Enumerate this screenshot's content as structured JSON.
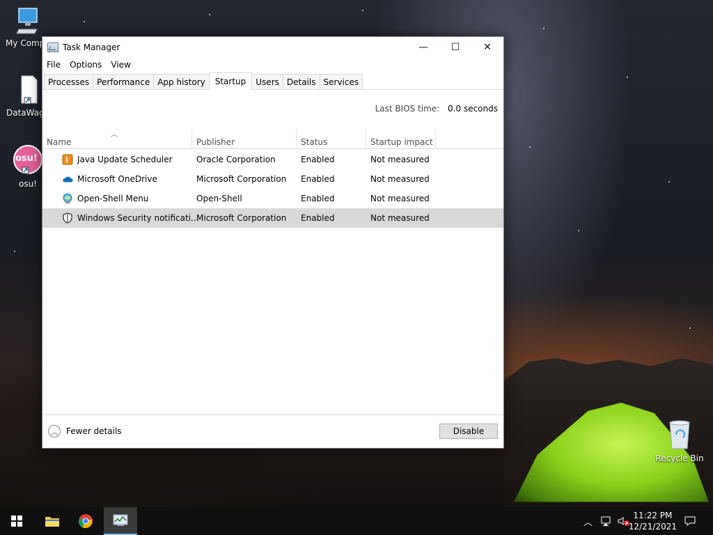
{
  "desktop": {
    "icons": [
      {
        "label": "My Compu"
      },
      {
        "label": "DataWago"
      },
      {
        "label": "osu!",
        "badge": "osu!"
      },
      {
        "label": "Recycle Bin"
      }
    ]
  },
  "window": {
    "title": "Task Manager",
    "controls": {
      "minimize": "—",
      "maximize": "☐",
      "close": "✕"
    },
    "menu": [
      "File",
      "Options",
      "View"
    ],
    "tabs": [
      "Processes",
      "Performance",
      "App history",
      "Startup",
      "Users",
      "Details",
      "Services"
    ],
    "active_tab": "Startup",
    "bios": {
      "label": "Last BIOS time:",
      "value": "0.0 seconds"
    },
    "columns": [
      "Name",
      "Publisher",
      "Status",
      "Startup impact"
    ],
    "rows": [
      {
        "name": "Java Update Scheduler",
        "publisher": "Oracle Corporation",
        "status": "Enabled",
        "impact": "Not measured",
        "icon": "java-icon"
      },
      {
        "name": "Microsoft OneDrive",
        "publisher": "Microsoft Corporation",
        "status": "Enabled",
        "impact": "Not measured",
        "icon": "onedrive-icon"
      },
      {
        "name": "Open-Shell Menu",
        "publisher": "Open-Shell",
        "status": "Enabled",
        "impact": "Not measured",
        "icon": "open-shell-icon"
      },
      {
        "name": "Windows Security notificati...",
        "publisher": "Microsoft Corporation",
        "status": "Enabled",
        "impact": "Not measured",
        "icon": "shield-icon",
        "selected": true
      }
    ],
    "footer": {
      "fewer_details": "Fewer details",
      "disable": "Disable"
    }
  },
  "taskbar": {
    "clock_time": "11:22 PM",
    "clock_date": "12/21/2021"
  },
  "colors": {
    "selected_row": "#d9d9d9",
    "taskbar": "#101010",
    "accent": "#76b9ed"
  }
}
